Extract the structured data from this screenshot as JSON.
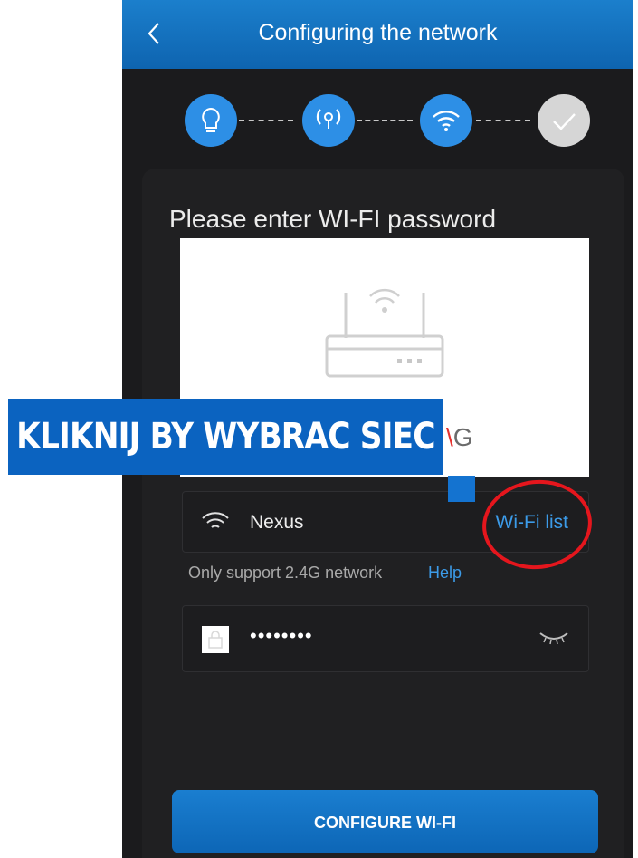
{
  "header": {
    "title": "Configuring the network"
  },
  "steps": [
    {
      "icon": "lightbulb-icon",
      "state": "active"
    },
    {
      "icon": "broadcast-icon",
      "state": "active"
    },
    {
      "icon": "wifi-icon",
      "state": "active"
    },
    {
      "icon": "checkmark-icon",
      "state": "pending"
    }
  ],
  "form": {
    "prompt": "Please enter WI-FI password",
    "ssid": "Nexus",
    "wifi_list_label": "Wi-Fi list",
    "support_text": "Only support 2.4G network",
    "help_label": "Help",
    "password_value": "••••••••",
    "submit_label": "CONFIGURE WI-FI"
  },
  "overlay": {
    "banner_text": "KLIKNIJ BY WYBRAC SIEC",
    "partial_text": "G"
  },
  "colors": {
    "accent": "#0e64b0",
    "link": "#3c9be8",
    "annotation": "#e5161d"
  }
}
